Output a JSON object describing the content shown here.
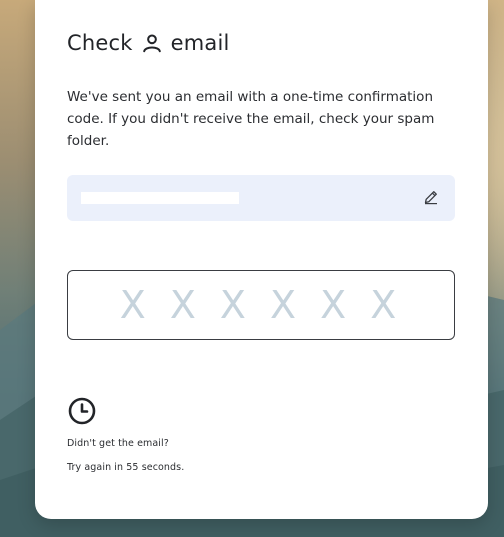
{
  "header": {
    "title_part1": "Check",
    "title_icon": "person-icon",
    "title_part2": "email"
  },
  "description": "We've sent you an email with a one-time confirmation code. If you didn't receive the email, check your spam folder.",
  "email": {
    "value": "",
    "redacted": true,
    "edit_icon": "pencil-icon"
  },
  "code_input": {
    "placeholder": "XXXXXX",
    "value": ""
  },
  "resend": {
    "icon": "clock-icon",
    "prompt": "Didn't get the email?",
    "countdown_text": "Try again in 55 seconds.",
    "seconds_remaining": 55
  },
  "colors": {
    "card_bg": "#ffffff",
    "email_box_bg": "#ebf0fb",
    "placeholder": "#c6d3dc",
    "text": "#2b2d31"
  }
}
